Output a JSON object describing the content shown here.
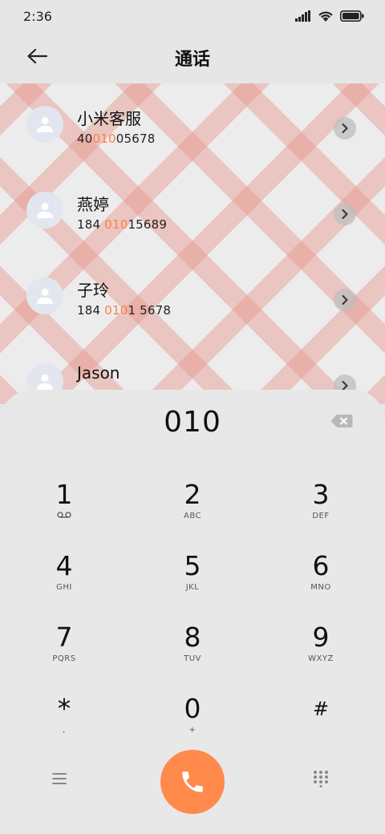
{
  "status_bar": {
    "time": "2:36"
  },
  "header": {
    "title": "通话"
  },
  "contacts": [
    {
      "name": "小米客服",
      "number_parts": [
        "40",
        "010",
        "05678"
      ]
    },
    {
      "name": "燕婷",
      "number_parts": [
        "184 ",
        "010",
        "15689"
      ]
    },
    {
      "name": "子玲",
      "number_parts": [
        "184 ",
        "010",
        "1 5678"
      ]
    },
    {
      "name": "Jason",
      "number_parts": [
        "",
        "",
        ""
      ]
    }
  ],
  "dialpad": {
    "input": "010",
    "keys": [
      {
        "digit": "1",
        "letters": ""
      },
      {
        "digit": "2",
        "letters": "ABC"
      },
      {
        "digit": "3",
        "letters": "DEF"
      },
      {
        "digit": "4",
        "letters": "GHI"
      },
      {
        "digit": "5",
        "letters": "JKL"
      },
      {
        "digit": "6",
        "letters": "MNO"
      },
      {
        "digit": "7",
        "letters": "PQRS"
      },
      {
        "digit": "8",
        "letters": "TUV"
      },
      {
        "digit": "9",
        "letters": "WXYZ"
      },
      {
        "digit": "*",
        "letters": ","
      },
      {
        "digit": "0",
        "letters": "+"
      },
      {
        "digit": "#",
        "letters": ""
      }
    ]
  },
  "icons": {
    "back": "arrow-left-icon",
    "voicemail": "voicemail-icon",
    "backspace": "backspace-icon",
    "menu": "menu-icon",
    "call": "phone-icon",
    "dialpad": "dialpad-icon"
  },
  "colors": {
    "accent": "#ff8a4c",
    "highlight": "#ff7f40"
  }
}
